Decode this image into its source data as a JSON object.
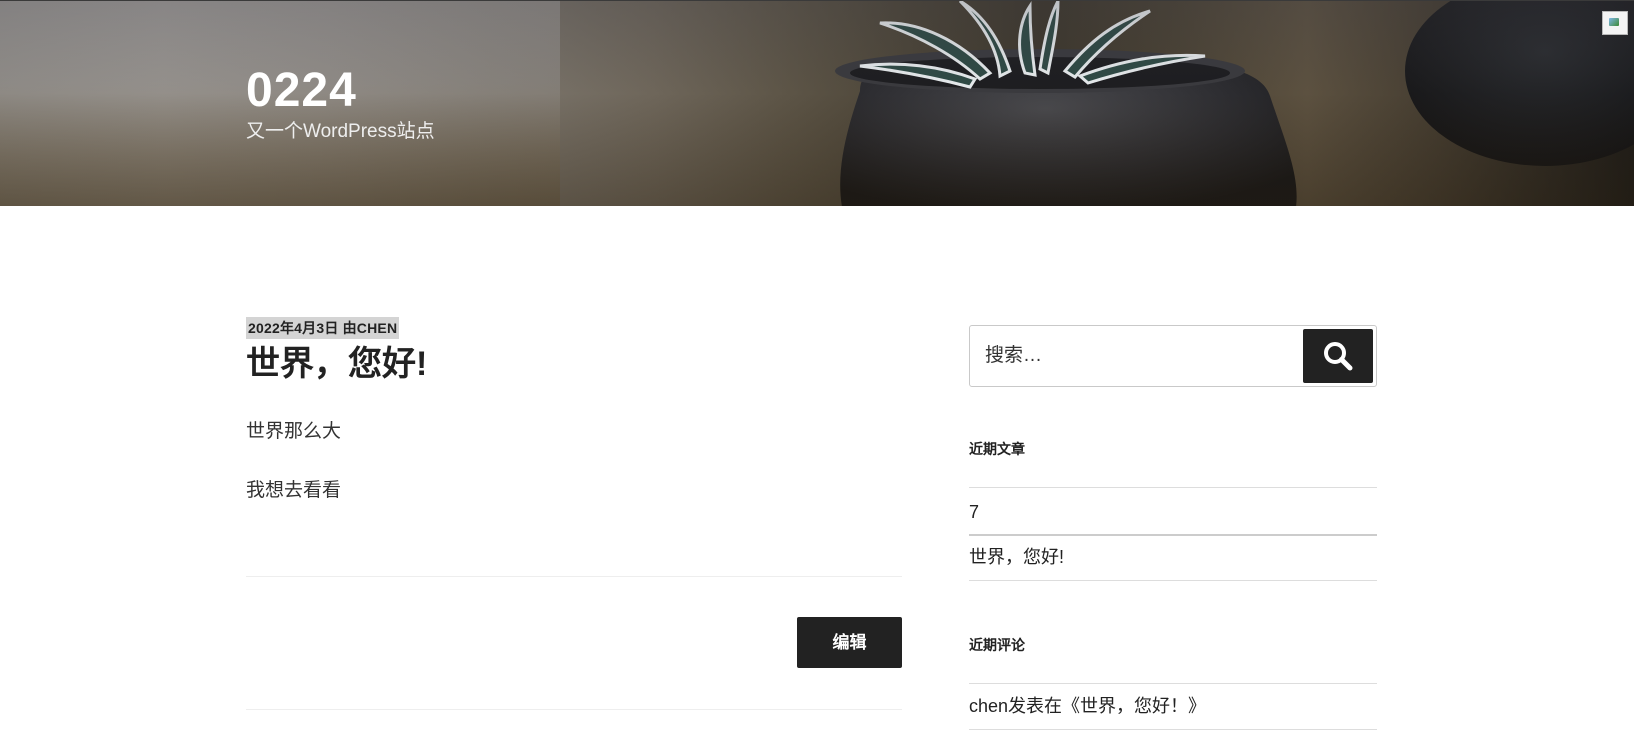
{
  "header": {
    "site_title": "0224",
    "site_description": "又一个WordPress站点",
    "broken_image_alt": ""
  },
  "post": {
    "meta": "2022年4月3日 由CHEN",
    "title": "世界，您好!",
    "paragraphs": [
      "世界那么大",
      "我想去看看"
    ],
    "edit_label": "编辑"
  },
  "sidebar": {
    "search": {
      "placeholder": "搜索…",
      "button_icon": "search-icon"
    },
    "recent_posts": {
      "title": "近期文章",
      "items": [
        "7",
        "世界，您好!"
      ]
    },
    "recent_comments": {
      "title": "近期评论",
      "items": [
        "chen发表在《世界，您好！》"
      ]
    }
  },
  "colors": {
    "text": "#222222",
    "button_bg": "#222222",
    "meta_highlight": "#d4d4d4",
    "header_title": "#ffffff"
  }
}
